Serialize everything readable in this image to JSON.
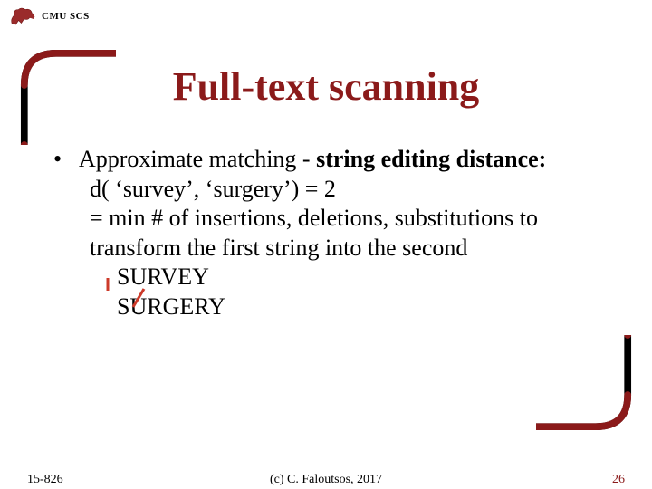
{
  "header": {
    "org": "CMU SCS"
  },
  "title": "Full-text scanning",
  "bullet": {
    "lead": "Approximate matching - ",
    "bold": "string editing distance:",
    "line2": "d( ‘survey’, ‘surgery’) = 2",
    "line3": "= min # of insertions, deletions, substitutions to transform the first string into the second",
    "word1": "SURVEY",
    "word2": "SURGERY"
  },
  "footer": {
    "left": "15-826",
    "center": "(c) C. Faloutsos, 2017",
    "right": "26"
  },
  "marks": {
    "insert_desc": "insertion mark",
    "subst_desc": "substitution mark"
  }
}
